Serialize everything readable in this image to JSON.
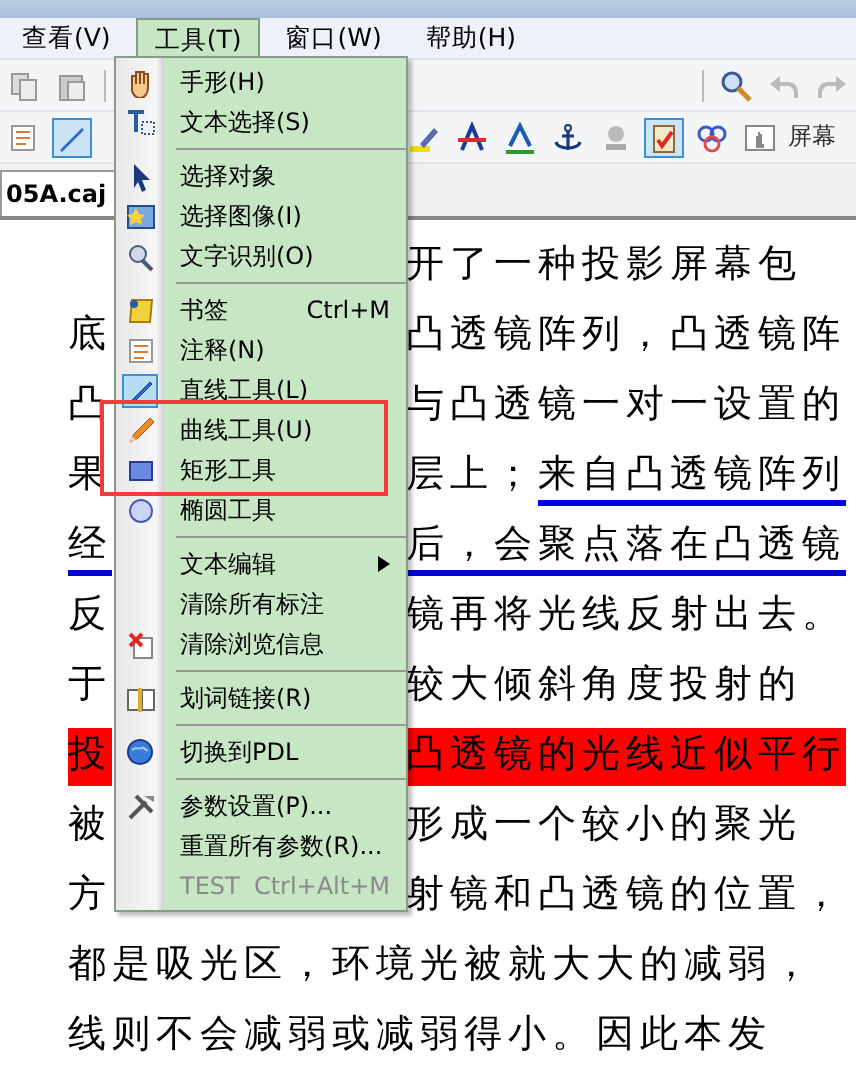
{
  "menubar": [
    {
      "label": "查看(V)",
      "selected": false
    },
    {
      "label": "工具(T)",
      "selected": true
    },
    {
      "label": "窗口(W)",
      "selected": false
    },
    {
      "label": "帮助(H)",
      "selected": false
    }
  ],
  "toolbar_2": {
    "tools": [
      {
        "selected": false
      },
      {
        "selected": true
      },
      {
        "selected": false
      },
      {
        "selected": false
      },
      {
        "selected": false
      },
      {
        "selected": false
      },
      {
        "selected": false
      },
      {
        "selected": true
      },
      {
        "selected": false
      },
      {
        "selected": false
      }
    ],
    "label": "屏幕"
  },
  "tab": {
    "label": "05A.caj"
  },
  "document": {
    "lines": [
      {
        "right": [
          {
            "text": "开了一种投影屏幕包",
            "underlined": false,
            "highlighted": false
          }
        ]
      },
      {
        "left": [
          {
            "text": "底",
            "underlined": false,
            "highlighted": false
          }
        ],
        "right": [
          {
            "text": "凸透镜阵列，凸透镜阵",
            "underlined": false,
            "highlighted": false
          }
        ]
      },
      {
        "left": [
          {
            "text": "凸",
            "underlined": false,
            "highlighted": false
          }
        ],
        "right": [
          {
            "text": "与凸透镜一对一设置的",
            "underlined": false,
            "highlighted": false
          }
        ]
      },
      {
        "left": [
          {
            "text": "果",
            "underlined": false,
            "highlighted": false
          }
        ],
        "right": [
          {
            "text": "层上；",
            "underlined": false,
            "highlighted": false
          },
          {
            "text": "来自凸透镜阵列",
            "underlined": true,
            "highlighted": false
          }
        ]
      },
      {
        "left": [
          {
            "text": "经",
            "underlined": true,
            "highlighted": false
          }
        ],
        "right": [
          {
            "text": "后，会聚点落在凸透镜",
            "underlined": true,
            "highlighted": false
          }
        ]
      },
      {
        "left": [
          {
            "text": "反",
            "underlined": false,
            "highlighted": false
          }
        ],
        "right": [
          {
            "text": "镜再将光线反射出去。",
            "underlined": false,
            "highlighted": false
          }
        ]
      },
      {
        "left": [
          {
            "text": "于",
            "underlined": false,
            "highlighted": false
          }
        ],
        "right": [
          {
            "text": "较大倾斜角度投射的",
            "underlined": false,
            "highlighted": false
          }
        ]
      },
      {
        "left": [
          {
            "text": "投",
            "underlined": false,
            "highlighted": true
          }
        ],
        "right": [
          {
            "text": "凸透镜的光线近似平行",
            "underlined": false,
            "highlighted": true
          }
        ]
      },
      {
        "left": [
          {
            "text": "被",
            "underlined": false,
            "highlighted": false
          }
        ],
        "right": [
          {
            "text": "形成一个较小的聚光",
            "underlined": false,
            "highlighted": false
          }
        ]
      },
      {
        "left": [
          {
            "text": "方",
            "underlined": false,
            "highlighted": false
          }
        ],
        "right": [
          {
            "text": "射镜和凸透镜的位置，",
            "underlined": false,
            "highlighted": false
          }
        ]
      },
      {
        "full": [
          {
            "text": "都是吸光区，环境光被就大大的减弱，",
            "underlined": false,
            "highlighted": false
          }
        ]
      },
      {
        "full": [
          {
            "text": "线则不会减弱或减弱得小。因此本发",
            "underlined": false,
            "highlighted": false
          }
        ]
      }
    ]
  },
  "menu": {
    "items": [
      {
        "kind": "item",
        "label": "手形(H)",
        "checked": false,
        "disabled": false
      },
      {
        "kind": "item",
        "label": "文本选择(S)",
        "checked": false,
        "disabled": false
      },
      {
        "kind": "separator"
      },
      {
        "kind": "item",
        "label": "选择对象",
        "checked": false,
        "disabled": false
      },
      {
        "kind": "item",
        "label": "选择图像(I)",
        "checked": false,
        "disabled": false
      },
      {
        "kind": "item",
        "label": "文字识别(O)",
        "checked": false,
        "disabled": false
      },
      {
        "kind": "separator"
      },
      {
        "kind": "item",
        "label": "书签",
        "shortcut": "Ctrl+M",
        "checked": false,
        "disabled": false
      },
      {
        "kind": "item",
        "label": "注释(N)",
        "checked": false,
        "disabled": false
      },
      {
        "kind": "item",
        "label": "直线工具(L)",
        "checked": true,
        "disabled": false
      },
      {
        "kind": "item",
        "label": "曲线工具(U)",
        "checked": false,
        "disabled": false
      },
      {
        "kind": "item",
        "label": "矩形工具",
        "checked": false,
        "disabled": false
      },
      {
        "kind": "item",
        "label": "椭圆工具",
        "checked": false,
        "disabled": false
      },
      {
        "kind": "separator"
      },
      {
        "kind": "submenu",
        "label": "文本编辑",
        "checked": false,
        "disabled": false
      },
      {
        "kind": "item",
        "label": "清除所有标注",
        "checked": false,
        "disabled": false
      },
      {
        "kind": "item",
        "label": "清除浏览信息",
        "checked": false,
        "disabled": false
      },
      {
        "kind": "separator"
      },
      {
        "kind": "item",
        "label": "划词链接(R)",
        "checked": false,
        "disabled": false
      },
      {
        "kind": "separator"
      },
      {
        "kind": "item",
        "label": "切换到PDL",
        "checked": false,
        "disabled": false
      },
      {
        "kind": "separator"
      },
      {
        "kind": "item",
        "label": "参数设置(P)...",
        "checked": false,
        "disabled": false
      },
      {
        "kind": "item",
        "label": "重置所有参数(R)...",
        "checked": false,
        "disabled": false
      },
      {
        "kind": "item",
        "label": "TEST",
        "shortcut": "Ctrl+Alt+M",
        "checked": false,
        "disabled": true
      }
    ]
  }
}
